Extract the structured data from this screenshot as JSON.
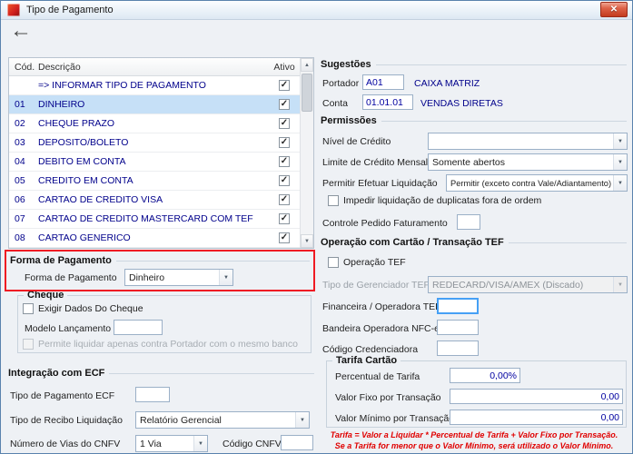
{
  "window": {
    "title": "Tipo de Pagamento"
  },
  "icons": {
    "close": "✕",
    "back": "←",
    "scroll_up": "▲",
    "scroll_down": "▼",
    "combo_arrow": "▼",
    "check": "✓"
  },
  "grid": {
    "headers": {
      "cod": "Cód.",
      "desc": "Descrição",
      "ativo": "Ativo"
    },
    "rows": [
      {
        "cod": "",
        "desc": "=> INFORMAR TIPO DE PAGAMENTO",
        "ativo": true,
        "selected": false
      },
      {
        "cod": "01",
        "desc": "DINHEIRO",
        "ativo": true,
        "selected": true
      },
      {
        "cod": "02",
        "desc": "CHEQUE PRAZO",
        "ativo": true,
        "selected": false
      },
      {
        "cod": "03",
        "desc": "DEPOSITO/BOLETO",
        "ativo": true,
        "selected": false
      },
      {
        "cod": "04",
        "desc": "DEBITO EM CONTA",
        "ativo": true,
        "selected": false
      },
      {
        "cod": "05",
        "desc": "CREDITO EM CONTA",
        "ativo": true,
        "selected": false
      },
      {
        "cod": "06",
        "desc": "CARTAO DE CREDITO VISA",
        "ativo": true,
        "selected": false
      },
      {
        "cod": "07",
        "desc": "CARTAO DE CREDITO MASTERCARD COM TEF",
        "ativo": true,
        "selected": false
      },
      {
        "cod": "08",
        "desc": "CARTAO GENERICO",
        "ativo": true,
        "selected": false
      }
    ]
  },
  "forma_pagamento": {
    "group_title": "Forma de Pagamento",
    "label": "Forma de Pagamento",
    "value": "Dinheiro"
  },
  "cheque": {
    "group_title": "Cheque",
    "exigir_label": "Exigir Dados Do Cheque",
    "modelo_label": "Modelo Lançamento",
    "modelo_value": "",
    "permite_label": "Permite liquidar apenas contra Portador com o mesmo banco"
  },
  "ecf": {
    "group_title": "Integração com ECF",
    "tipo_pagamento_label": "Tipo de Pagamento ECF",
    "tipo_pagamento_value": "",
    "tipo_recibo_label": "Tipo de Recibo Liquidação",
    "tipo_recibo_value": "Relatório Gerencial",
    "vias_label": "Número de Vias do CNFV",
    "vias_value": "1 Via",
    "codigo_cnfv_label": "Código CNFV",
    "codigo_cnfv_value": ""
  },
  "sugestoes": {
    "group_title": "Sugestões",
    "portador_label": "Portador",
    "portador_value": "A01",
    "portador_desc": "CAIXA MATRIZ",
    "conta_label": "Conta",
    "conta_value": "01.01.01",
    "conta_desc": "VENDAS DIRETAS"
  },
  "permissoes": {
    "group_title": "Permissões",
    "nivel_label": "Nível de Crédito",
    "nivel_value": "",
    "limite_label": "Limite de Crédito Mensal",
    "limite_value": "Somente abertos",
    "liquidacao_label": "Permitir Efetuar Liquidação",
    "liquidacao_value": "Permitir (exceto contra Vale/Adiantamento)",
    "impedir_label": "Impedir liquidação de duplicatas fora de ordem",
    "controle_label": "Controle Pedido Faturamento",
    "controle_value": ""
  },
  "tef": {
    "group_title": "Operação com Cartão / Transação TEF",
    "operacao_label": "Operação TEF",
    "gerenciador_label": "Tipo de Gerenciador TEF",
    "gerenciador_value": "REDECARD/VISA/AMEX (Discado)",
    "financeira_label": "Financeira / Operadora TEF",
    "financeira_value": "",
    "bandeira_label": "Bandeira Operadora NFC-e",
    "bandeira_value": "",
    "credenciadora_label": "Código Credenciadora",
    "credenciadora_value": ""
  },
  "tarifa": {
    "group_title": "Tarifa Cartão",
    "percentual_label": "Percentual de Tarifa",
    "percentual_value": "0,00%",
    "fixo_label": "Valor Fixo por Transação",
    "fixo_value": "0,00",
    "minimo_label": "Valor Mínimo por Transação",
    "minimo_value": "0,00",
    "warning_line1": "Tarifa = Valor a Liquidar *  Percentual de Tarifa + Valor Fixo por Transação.",
    "warning_line2": "Se a Tarifa for menor que o Valor Mínimo, será utilizado o Valor Mínimo."
  },
  "colors": {
    "selected_row": "#c6e0f7",
    "grid_text": "#00008b",
    "value_text": "#0000a0",
    "warning_red": "#e00000",
    "highlight_red": "#ef1b23"
  }
}
